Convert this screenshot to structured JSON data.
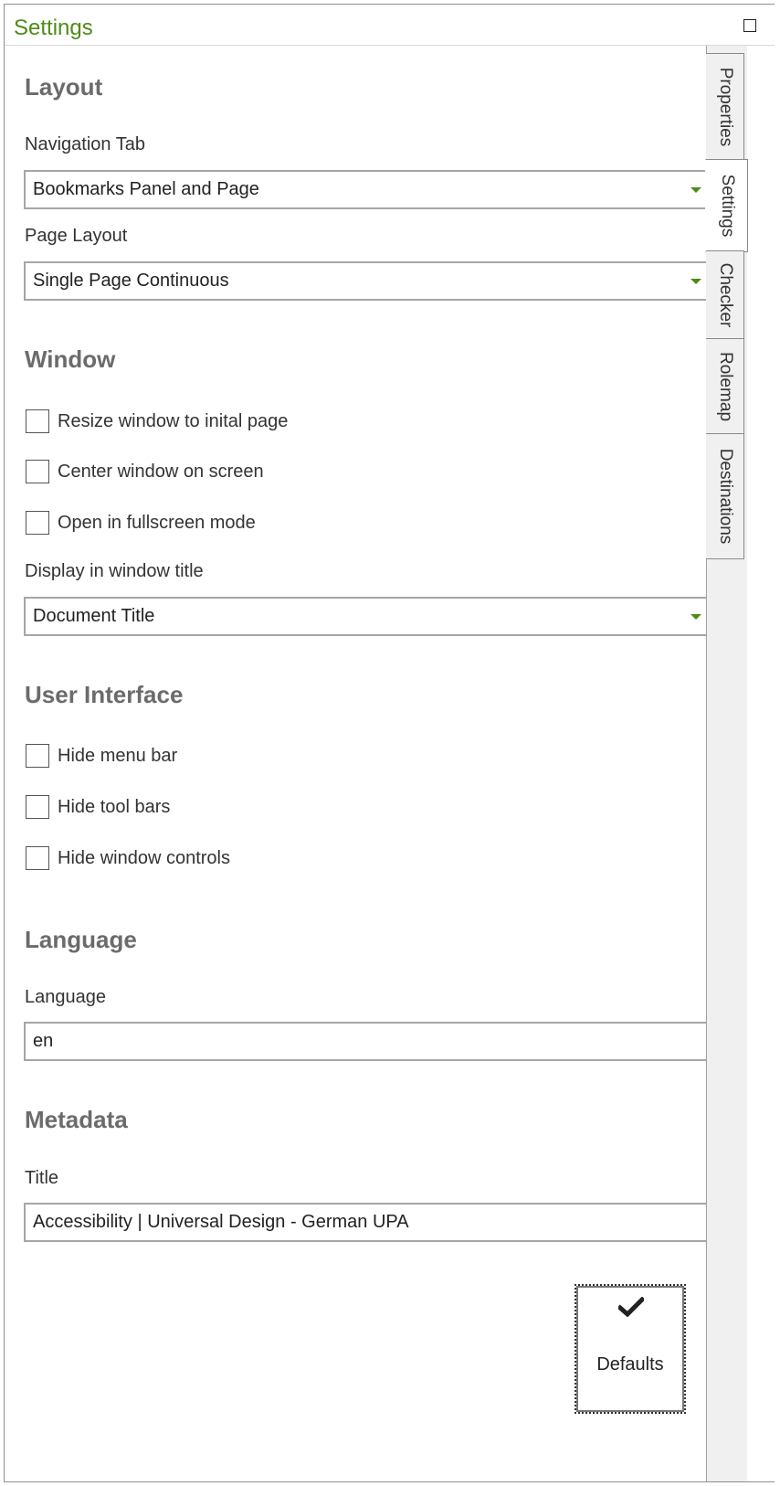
{
  "window": {
    "title": "Settings"
  },
  "tabs": [
    {
      "label": "Properties",
      "active": false
    },
    {
      "label": "Settings",
      "active": true
    },
    {
      "label": "Checker",
      "active": false
    },
    {
      "label": "Rolemap",
      "active": false
    },
    {
      "label": "Destinations",
      "active": false
    }
  ],
  "layout": {
    "heading": "Layout",
    "navigation_tab": {
      "label": "Navigation Tab",
      "value": "Bookmarks Panel and Page"
    },
    "page_layout": {
      "label": "Page Layout",
      "value": "Single Page Continuous"
    }
  },
  "window_section": {
    "heading": "Window",
    "checkboxes": [
      {
        "label": "Resize window to inital page",
        "checked": false
      },
      {
        "label": "Center window on screen",
        "checked": false
      },
      {
        "label": "Open in fullscreen mode",
        "checked": false
      }
    ],
    "display_title": {
      "label": "Display in window title",
      "value": "Document Title"
    }
  },
  "user_interface": {
    "heading": "User Interface",
    "checkboxes": [
      {
        "label": "Hide menu bar",
        "checked": false
      },
      {
        "label": "Hide tool bars",
        "checked": false
      },
      {
        "label": "Hide window controls",
        "checked": false
      }
    ]
  },
  "language": {
    "heading": "Language",
    "field": {
      "label": "Language",
      "value": "en"
    }
  },
  "metadata": {
    "heading": "Metadata",
    "field": {
      "label": "Title",
      "value": "Accessibility | Universal Design - German UPA"
    }
  },
  "defaults_button": {
    "label": "Defaults",
    "icon": "checkmark-icon"
  },
  "colors": {
    "accent": "#4e8b17",
    "heading": "#6b6b6b",
    "border": "#a6a6a6",
    "tab_bg": "#f0f0f0"
  }
}
